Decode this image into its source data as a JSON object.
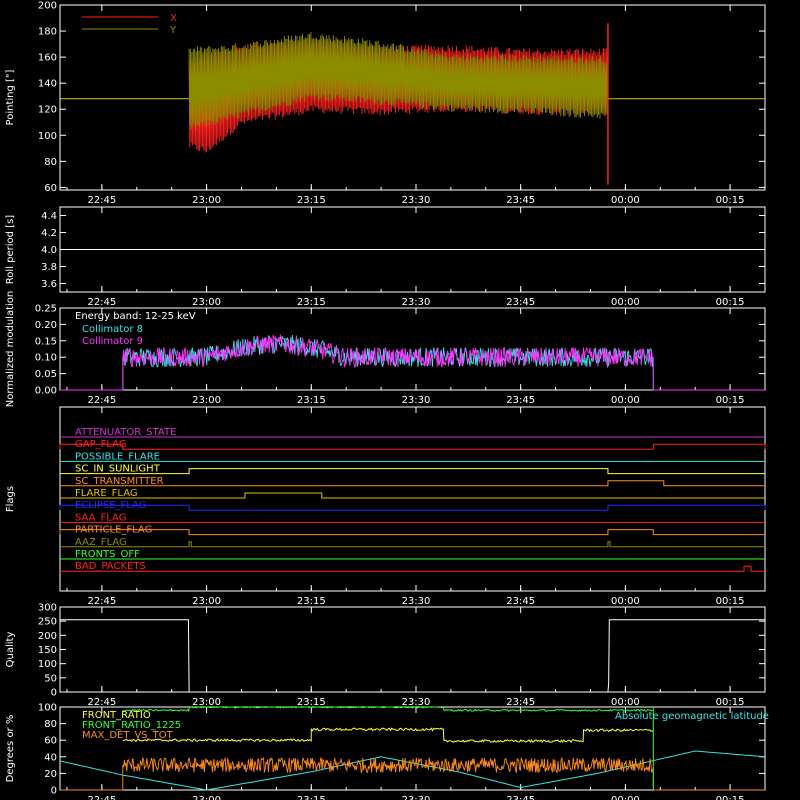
{
  "colors": {
    "background": "#000000",
    "axes": "#ffffff",
    "red": "#ff2020",
    "olive": "#8c8c00",
    "cyan": "#33e6e6",
    "magenta": "#ff33ff",
    "yellow": "#ffff33",
    "green": "#33ff33",
    "orange": "#ff8c1a",
    "blue": "#2626ff",
    "purple": "#cc33cc",
    "gold": "#e0c000"
  },
  "x_axis": {
    "range_minutes": [
      -21,
      80
    ],
    "tick_minutes": [
      -15,
      0,
      15,
      30,
      45,
      60,
      75
    ],
    "tick_labels": [
      "22:45",
      "23:00",
      "23:15",
      "23:30",
      "23:45",
      "00:00",
      "00:15"
    ]
  },
  "chart_data": [
    {
      "id": "pointing",
      "type": "line",
      "ylabel": "Pointing [\"]",
      "ylim": [
        58,
        200
      ],
      "yticks": [
        60,
        80,
        100,
        120,
        140,
        160,
        180,
        200
      ],
      "legend": [
        {
          "name": "X",
          "color": "#ff2020"
        },
        {
          "name": "Y",
          "color": "#8c8c00"
        }
      ],
      "baseline": 128,
      "active_range_minutes": [
        -2.5,
        57.5
      ],
      "x_band": {
        "upper": [
          [
            -2.5,
            157
          ],
          [
            5,
            167
          ],
          [
            15,
            172
          ],
          [
            25,
            166
          ],
          [
            35,
            167
          ],
          [
            45,
            164
          ],
          [
            57.5,
            164
          ]
        ],
        "lower": [
          [
            -2.5,
            92
          ],
          [
            0,
            88
          ],
          [
            5,
            110
          ],
          [
            15,
            120
          ],
          [
            25,
            118
          ],
          [
            35,
            121
          ],
          [
            45,
            119
          ],
          [
            57.5,
            118
          ]
        ]
      },
      "y_band": {
        "upper": [
          [
            -2.5,
            165
          ],
          [
            5,
            168
          ],
          [
            15,
            177
          ],
          [
            25,
            170
          ],
          [
            35,
            160
          ],
          [
            45,
            159
          ],
          [
            57.5,
            158
          ]
        ],
        "lower": [
          [
            -2.5,
            105
          ],
          [
            5,
            116
          ],
          [
            15,
            130
          ],
          [
            25,
            126
          ],
          [
            35,
            121
          ],
          [
            45,
            119
          ],
          [
            57.5,
            115
          ]
        ]
      }
    },
    {
      "id": "roll",
      "type": "line",
      "ylabel": "Roll period [s]",
      "ylim": [
        3.5,
        4.5
      ],
      "yticks": [
        3.6,
        3.8,
        4.0,
        4.2,
        4.4
      ],
      "series": [
        {
          "color": "#ffffff",
          "x": [
            -21,
            80
          ],
          "y": [
            4.0,
            4.0
          ]
        }
      ]
    },
    {
      "id": "modulation",
      "type": "line",
      "ylabel": "Normalized modulation",
      "ylim": [
        0,
        0.25
      ],
      "yticks": [
        0.0,
        0.05,
        0.1,
        0.15,
        0.2,
        0.25
      ],
      "annotation": "Energy band: 12-25 keV",
      "legend": [
        {
          "name": "Collimator 8",
          "color": "#33e6e6"
        },
        {
          "name": "Collimator 9",
          "color": "#ff33ff"
        }
      ],
      "active_range_minutes": [
        -12,
        64
      ],
      "level": 0.1
    },
    {
      "id": "flags",
      "type": "line",
      "ylabel": "Flags",
      "flags": [
        {
          "name": "ATTENUATOR_STATE",
          "color": "#cc33cc",
          "highs": []
        },
        {
          "name": "GAP_FLAG",
          "color": "#ff2020",
          "highs": [
            [
              -21,
              -12
            ],
            [
              64,
              80
            ]
          ]
        },
        {
          "name": "POSSIBLE_FLARE",
          "color": "#33e6e6",
          "highs": []
        },
        {
          "name": "SC_IN_SUNLIGHT",
          "color": "#ffff33",
          "highs": [
            [
              -2.5,
              57.5
            ]
          ]
        },
        {
          "name": "SC_TRANSMITTER",
          "color": "#ff8c1a",
          "highs": [
            [
              57.5,
              65.5
            ]
          ]
        },
        {
          "name": "FLARE_FLAG",
          "color": "#e0c000",
          "highs": [
            [
              5.5,
              16.5
            ]
          ]
        },
        {
          "name": "ECLIPSE_FLAG",
          "color": "#2626ff",
          "highs": [
            [
              -21,
              -2.5
            ],
            [
              57.5,
              80
            ]
          ]
        },
        {
          "name": "SAA_FLAG",
          "color": "#ff2020",
          "highs": []
        },
        {
          "name": "PARTICLE_FLAG",
          "color": "#ff8c1a",
          "highs": [
            [
              -21,
              -2.5
            ],
            [
              57.5,
              64
            ]
          ]
        },
        {
          "name": "AAZ_FLAG",
          "color": "#8c8c00",
          "highs": [
            [
              -2.5,
              -2.2
            ],
            [
              57.5,
              57.8
            ]
          ]
        },
        {
          "name": "FRONTS_OFF",
          "color": "#33ff33",
          "highs": []
        },
        {
          "name": "BAD_PACKETS",
          "color": "#ff2020",
          "highs": [
            [
              77,
              78
            ]
          ]
        }
      ]
    },
    {
      "id": "quality",
      "type": "line",
      "ylabel": "Quality",
      "ylim": [
        0,
        300
      ],
      "yticks": [
        0,
        50,
        100,
        150,
        200,
        250,
        300
      ],
      "series": [
        {
          "color": "#ffffff",
          "x": [
            -21,
            -2.6,
            -2.5,
            57.5,
            57.6,
            57.7,
            80
          ],
          "y": [
            255,
            255,
            0,
            0,
            30,
            255,
            255
          ]
        }
      ]
    },
    {
      "id": "geomag",
      "type": "line",
      "ylabel": "Degrees or %",
      "ylim": [
        0,
        100
      ],
      "yticks": [
        0,
        20,
        40,
        60,
        80,
        100
      ],
      "legend": [
        {
          "name": "FRONT_RATIO",
          "color": "#ffff33"
        },
        {
          "name": "FRONT_RATIO_1225",
          "color": "#33ff33"
        },
        {
          "name": "MAX_DET_VS_TOT",
          "color": "#ff8c1a"
        }
      ],
      "right_label": "Absolute geomagnetic latitude",
      "right_label_color": "#33e6e6",
      "active_range_minutes": [
        -12,
        64
      ],
      "front_ratio_steps": [
        [
          -12,
          60
        ],
        [
          15,
          60
        ],
        [
          15,
          73
        ],
        [
          34,
          73
        ],
        [
          34,
          59
        ],
        [
          54,
          59
        ],
        [
          54,
          72
        ],
        [
          64,
          72
        ]
      ],
      "front_ratio_1225_steps": [
        [
          -12,
          96
        ],
        [
          -2.5,
          96
        ],
        [
          -2.5,
          100
        ],
        [
          34,
          100
        ],
        [
          34,
          96
        ],
        [
          64,
          96
        ]
      ],
      "max_det_level": 30,
      "geomag_latitude": {
        "x": [
          -21,
          -12,
          0,
          15,
          25,
          36,
          45,
          56,
          70,
          80
        ],
        "y": [
          35,
          18,
          0,
          22,
          40,
          22,
          3,
          20,
          47,
          40
        ]
      }
    }
  ]
}
